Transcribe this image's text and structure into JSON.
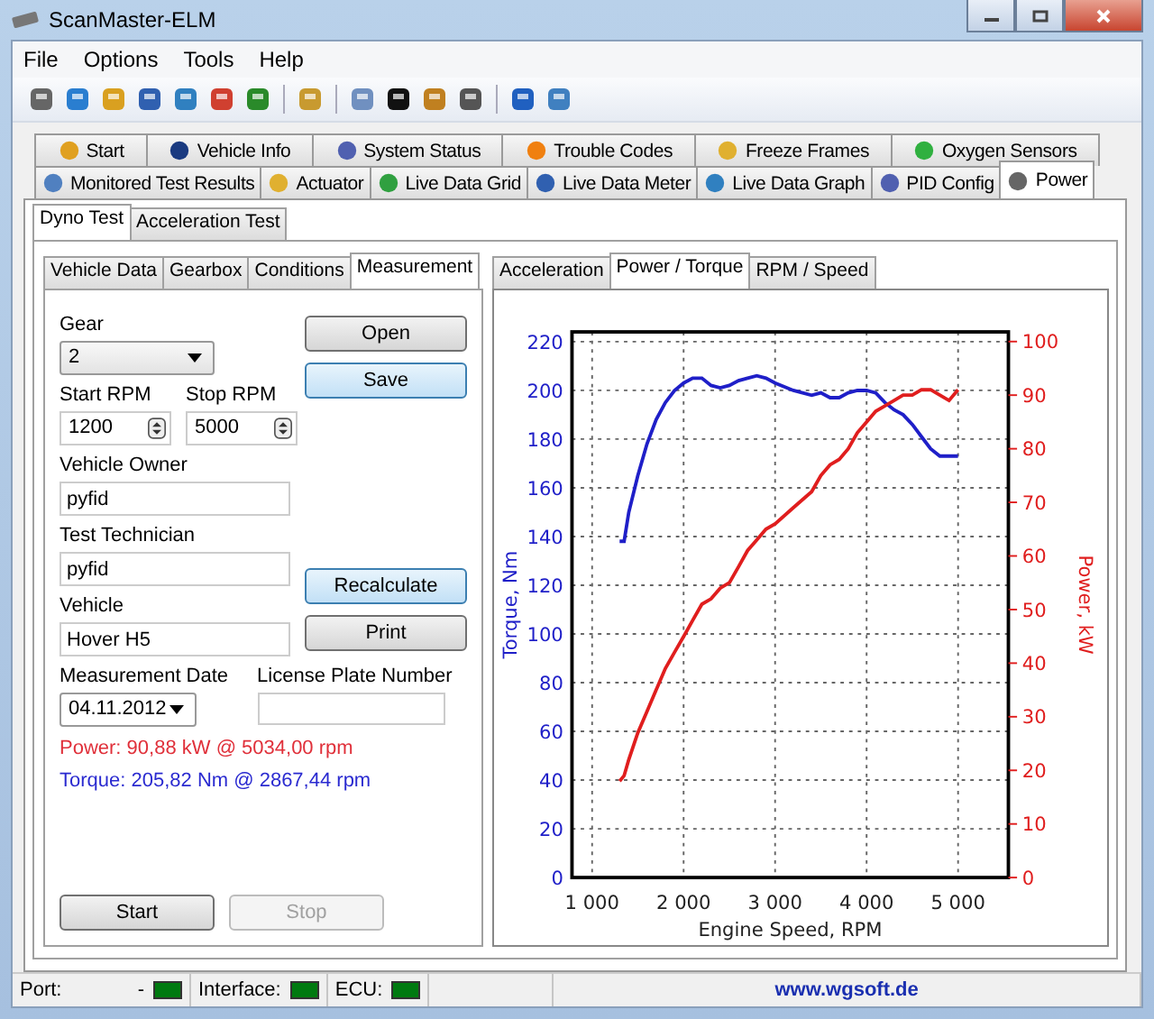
{
  "window": {
    "title": "ScanMaster-ELM"
  },
  "menu": [
    "File",
    "Options",
    "Tools",
    "Help"
  ],
  "main_tabs": [
    [
      {
        "label": "Start",
        "selected": false
      },
      {
        "label": "Vehicle Info",
        "selected": false
      },
      {
        "label": "System Status",
        "selected": false
      },
      {
        "label": "Trouble Codes",
        "selected": false
      },
      {
        "label": "Freeze Frames",
        "selected": false
      },
      {
        "label": "Oxygen Sensors",
        "selected": false
      }
    ],
    [
      {
        "label": "Monitored Test Results",
        "selected": false
      },
      {
        "label": "Actuator",
        "selected": false
      },
      {
        "label": "Live Data Grid",
        "selected": false
      },
      {
        "label": "Live Data Meter",
        "selected": false
      },
      {
        "label": "Live Data Graph",
        "selected": false
      },
      {
        "label": "PID Config",
        "selected": false
      },
      {
        "label": "Power",
        "selected": true
      }
    ]
  ],
  "test_tabs": [
    {
      "label": "Dyno Test",
      "selected": true
    },
    {
      "label": "Acceleration Test",
      "selected": false
    }
  ],
  "form_tabs": [
    {
      "label": "Vehicle Data",
      "selected": false
    },
    {
      "label": "Gearbox",
      "selected": false
    },
    {
      "label": "Conditions",
      "selected": false
    },
    {
      "label": "Measurement",
      "selected": true
    }
  ],
  "form": {
    "gear": {
      "label": "Gear",
      "value": "2"
    },
    "start_rpm": {
      "label": "Start RPM",
      "value": "1200"
    },
    "stop_rpm": {
      "label": "Stop RPM",
      "value": "5000"
    },
    "vehicle_owner": {
      "label": "Vehicle Owner",
      "value": "pyfid"
    },
    "test_technician": {
      "label": "Test Technician",
      "value": "pyfid"
    },
    "vehicle": {
      "label": "Vehicle",
      "value": "Hover H5"
    },
    "measurement_date": {
      "label": "Measurement Date",
      "value": "04.11.2012"
    },
    "license_plate": {
      "label": "License Plate Number"
    },
    "buttons": [
      {
        "label": "Open",
        "focused": false
      },
      {
        "label": "Save",
        "focused": true
      },
      {
        "label": "Recalculate",
        "focused": true
      },
      {
        "label": "Print",
        "focused": false
      }
    ],
    "results": [
      {
        "text": "Power: 90,88 kW @ 5034,00 rpm",
        "color": "#e0303a"
      },
      {
        "text": "Torque: 205,82 Nm @ 2867,44 rpm",
        "color": "#2a2ad0"
      }
    ],
    "start_button": {
      "label": "Start",
      "disabled": false
    },
    "stop_button": {
      "label": "Stop",
      "disabled": true
    }
  },
  "chart_panel": {
    "tabs": [
      {
        "label": "Acceleration",
        "selected": false
      },
      {
        "label": "Power / Torque",
        "selected": true
      },
      {
        "label": "RPM / Speed",
        "selected": false
      }
    ],
    "chart_data": {
      "type": "line",
      "xlabel": "Engine Speed, RPM",
      "ylabel": "Torque, Nm",
      "y2label": "Power, kW",
      "x": [
        1300,
        1350,
        1400,
        1500,
        1600,
        1700,
        1800,
        1900,
        2000,
        2100,
        2200,
        2300,
        2400,
        2500,
        2600,
        2700,
        2800,
        2900,
        3000,
        3200,
        3400,
        3500,
        3600,
        3700,
        3800,
        3900,
        4000,
        4100,
        4200,
        4300,
        4400,
        4500,
        4600,
        4700,
        4800,
        4900,
        5000
      ],
      "series": [
        {
          "color": "#1f1fc8",
          "values": [
            138,
            138,
            150,
            165,
            178,
            188,
            195,
            200,
            203,
            205,
            205,
            202,
            201,
            202,
            204,
            205,
            206,
            205,
            203,
            200,
            198,
            199,
            197,
            197,
            199,
            200,
            200,
            199,
            195,
            192,
            190,
            186,
            181,
            176,
            173,
            173,
            173
          ]
        },
        {
          "color": "#e01e1e",
          "axis": "y2",
          "values": [
            18,
            19,
            22,
            27,
            31,
            35,
            39,
            42,
            45,
            48,
            51,
            52,
            54,
            55,
            58,
            61,
            63,
            65,
            66,
            69,
            72,
            75,
            77,
            78,
            80,
            83,
            85,
            87,
            88,
            89,
            90,
            90,
            91,
            91,
            90,
            89,
            91
          ]
        }
      ],
      "grid": true,
      "xlim": [
        780,
        5550
      ],
      "ylim": [
        0,
        224
      ],
      "y2lim": [
        0,
        101.8
      ],
      "xticks": [
        {
          "value": 1000,
          "label": "1 000"
        },
        {
          "value": 2000,
          "label": "2 000"
        },
        {
          "value": 3000,
          "label": "3 000"
        },
        {
          "value": 4000,
          "label": "4 000"
        },
        {
          "value": 5000,
          "label": "5 000"
        }
      ],
      "yticks": [
        0,
        20,
        40,
        60,
        80,
        100,
        120,
        140,
        160,
        180,
        200,
        220
      ],
      "y2ticks": [
        0,
        10,
        20,
        30,
        40,
        50,
        60,
        70,
        80,
        90,
        100
      ]
    }
  },
  "status_bar": {
    "port": {
      "label": "Port:",
      "value": "-",
      "color": "#007a10"
    },
    "interface": {
      "label": "Interface:",
      "color": "#007a10"
    },
    "ecu": {
      "label": "ECU:",
      "color": "#007a10"
    },
    "link": "www.wgsoft.de"
  }
}
